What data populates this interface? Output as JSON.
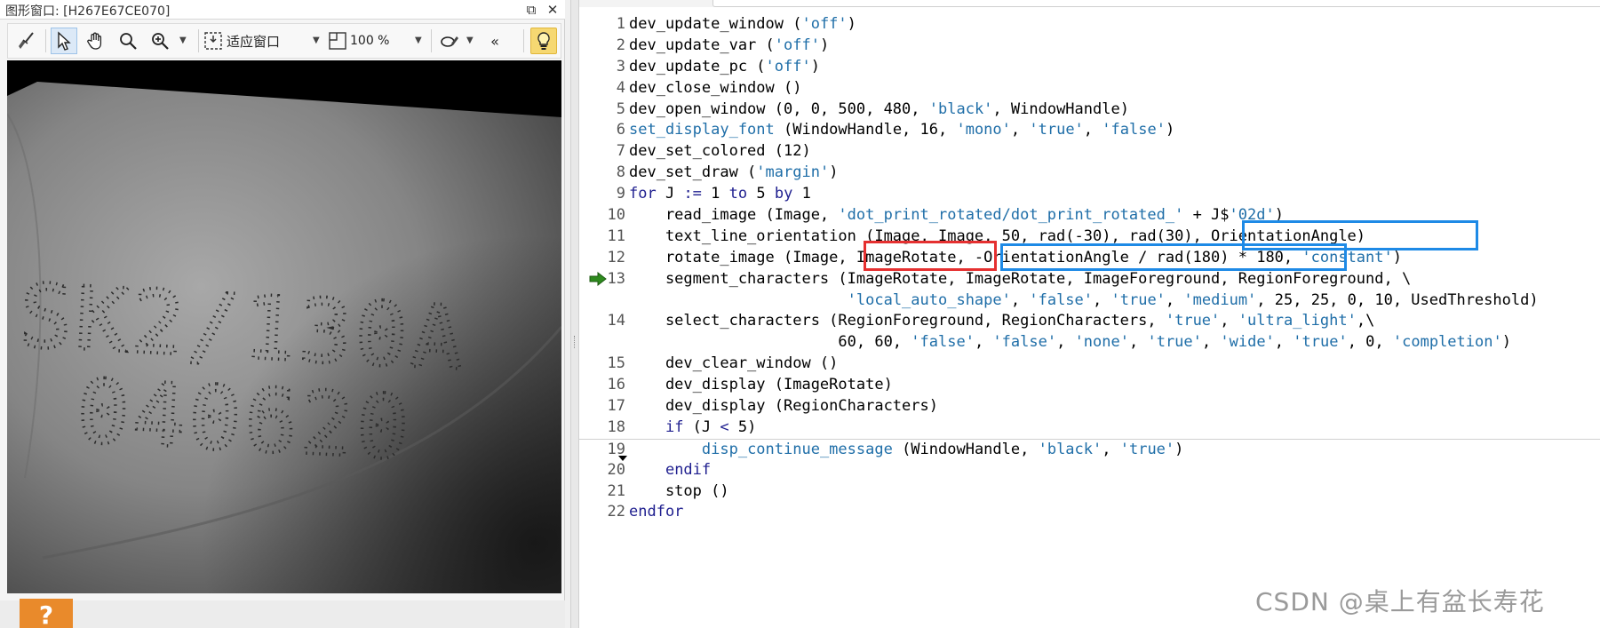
{
  "graphics_window": {
    "title": "图形窗口: [H267E67CE070]",
    "toolbar": {
      "fit_label": "适应窗口",
      "zoom_value": "100 %",
      "more_label": "«"
    }
  },
  "editor": {
    "lines": [
      {
        "num": "1",
        "code": "dev_update_window ('off')"
      },
      {
        "num": "2",
        "code": "dev_update_var ('off')"
      },
      {
        "num": "3",
        "code": "dev_update_pc ('off')"
      },
      {
        "num": "4",
        "code": "dev_close_window ()"
      },
      {
        "num": "5",
        "code": "dev_open_window (0, 0, 500, 480, 'black', WindowHandle)"
      },
      {
        "num": "6",
        "code": "set_display_font (WindowHandle, 16, 'mono', 'true', 'false')"
      },
      {
        "num": "7",
        "code": "dev_set_colored (12)"
      },
      {
        "num": "8",
        "code": "dev_set_draw ('margin')"
      },
      {
        "num": "9",
        "code": "for J := 1 to 5 by 1"
      },
      {
        "num": "10",
        "code": "    read_image (Image, 'dot_print_rotated/dot_print_rotated_' + J$'02d')"
      },
      {
        "num": "11",
        "code": "    text_line_orientation (Image, Image, 50, rad(-30), rad(30), OrientationAngle)"
      },
      {
        "num": "12",
        "code": "    rotate_image (Image, ImageRotate, -OrientationAngle / rad(180) * 180, 'constant')"
      },
      {
        "num": "13",
        "code": "    segment_characters (ImageRotate, ImageRotate, ImageForeground, RegionForeground, \\"
      },
      {
        "num": "",
        "code": "                        'local_auto_shape', 'false', 'true', 'medium', 25, 25, 0, 10, UsedThreshold)"
      },
      {
        "num": "14",
        "code": "    select_characters (RegionForeground, RegionCharacters, 'true', 'ultra_light',\\"
      },
      {
        "num": "",
        "code": "                       60, 60, 'false', 'false', 'none', 'true', 'wide', 'true', 0, 'completion')"
      },
      {
        "num": "15",
        "code": "    dev_clear_window ()"
      },
      {
        "num": "16",
        "code": "    dev_display (ImageRotate)"
      },
      {
        "num": "17",
        "code": "    dev_display (RegionCharacters)"
      },
      {
        "num": "18",
        "code": "    if (J < 5)"
      },
      {
        "num": "19",
        "code": "        disp_continue_message (WindowHandle, 'black', 'true')"
      },
      {
        "num": "20",
        "code": "    endif"
      },
      {
        "num": "21",
        "code": "    stop ()"
      },
      {
        "num": "22",
        "code": "endfor"
      }
    ]
  },
  "image_text": {
    "line1": "SK2/130A",
    "line2": "040620"
  },
  "watermark": "CSDN @桌上有盆长寿花",
  "help_tile_label": "?",
  "colors": {
    "highlight_blue": "#1e8ae6",
    "highlight_red": "#e53030",
    "keyword": "#1f1f8f",
    "string": "#1f6ea8",
    "pc_arrow": "#2e8b1e"
  }
}
